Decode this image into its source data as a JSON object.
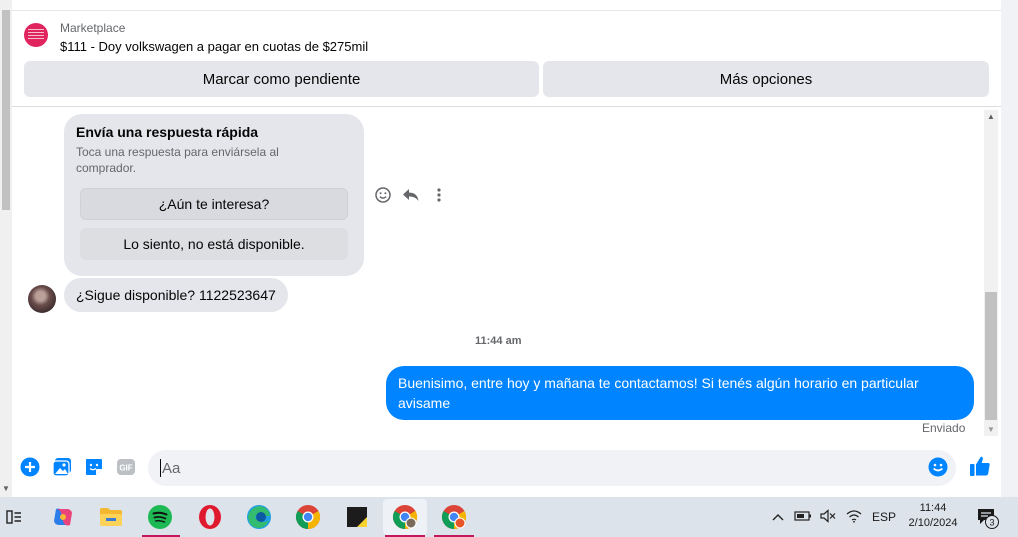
{
  "header": {
    "marketplace_label": "Marketplace",
    "listing_title": "$111 - Doy volkswagen a pagar en cuotas de $275mil",
    "btn_pending": "Marcar como pendiente",
    "btn_more": "Más opciones"
  },
  "quick_reply": {
    "title": "Envía una respuesta rápida",
    "subtitle": "Toca una respuesta para enviársela al comprador.",
    "option1": "¿Aún te interesa?",
    "option2": "Lo siento, no está disponible."
  },
  "messages": {
    "incoming": "¿Sigue disponible? 1122523647",
    "timestamp": "11:44 am",
    "outgoing": "Buenisimo, entre hoy y mañana te contactamos! Si tenés algún horario en particular avisame",
    "status": "Enviado"
  },
  "composer": {
    "placeholder": "Aa",
    "gif_label": "GIF"
  },
  "taskbar": {
    "language": "ESP",
    "time": "11:44",
    "date": "2/10/2024",
    "notification_count": "3"
  },
  "colors": {
    "accent": "#0084ff",
    "bubble_gray": "#e4e6eb",
    "taskbar": "#dde3ea"
  }
}
